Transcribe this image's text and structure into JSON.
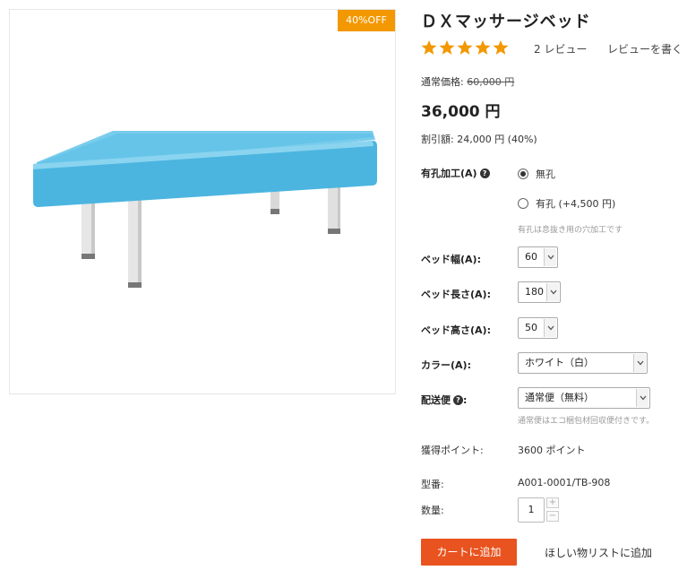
{
  "product": {
    "title": "ＤＸマッサージベッド",
    "badge": "40%OFF",
    "rating_stars": 5,
    "star_color": "#f39800",
    "reviews_count": "2 レビュー",
    "write_review": "レビューを書く",
    "regular_price_label": "通常価格:",
    "regular_price": "60,000 円",
    "price": "36,000 円",
    "discount": "割引額: 24,000 円 (40%)"
  },
  "options": {
    "hole_label": "有孔加工(A)",
    "hole_choices": [
      {
        "label": "無孔",
        "checked": true
      },
      {
        "label": "有孔 (+4,500 円)",
        "checked": false
      }
    ],
    "hole_hint": "有孔は息抜き用の穴加工です",
    "width_label": "ベッド幅(A):",
    "width_value": "60",
    "length_label": "ベッド長さ(A):",
    "length_value": "180",
    "height_label": "ベッド高さ(A):",
    "height_value": "50",
    "color_label": "カラー(A):",
    "color_value": "ホワイト（白）",
    "shipping_label": "配送便",
    "shipping_value": "通常便（無料）",
    "shipping_hint": "通常便はエコ梱包材回収便付きです。"
  },
  "info": {
    "points_label": "獲得ポイント:",
    "points_value": "3600 ポイント",
    "model_label": "型番:",
    "model_value": "A001-0001/TB-908",
    "qty_label": "数量:",
    "qty_value": "1"
  },
  "actions": {
    "cart": "カートに追加",
    "wishlist": "ほしい物リストに追加"
  },
  "colors": {
    "accent_orange": "#e8531f",
    "badge_orange": "#f39800",
    "bed_blue": "#5cc1e6"
  }
}
